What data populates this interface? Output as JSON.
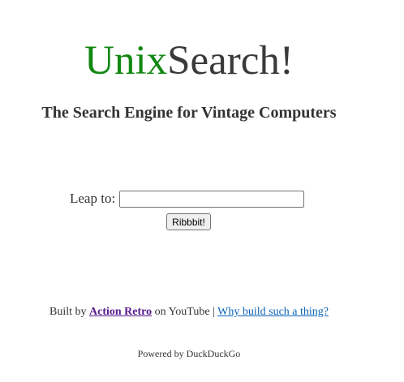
{
  "logo": {
    "part1": "Unix",
    "part2": "Search!",
    "part1_color": "#118811",
    "part2_color": "#3a3a3a"
  },
  "tagline": "The Search Engine for Vintage Computers",
  "search": {
    "label": "Leap to:",
    "value": "",
    "placeholder": "",
    "button_label": "Ribbbit!"
  },
  "credits": {
    "built_by": "Built by",
    "author_link": "Action Retro",
    "on_youtube": "on YouTube",
    "separator": "|",
    "why_link": "Why build such a thing?"
  },
  "powered_by": "Powered by DuckDuckGo"
}
